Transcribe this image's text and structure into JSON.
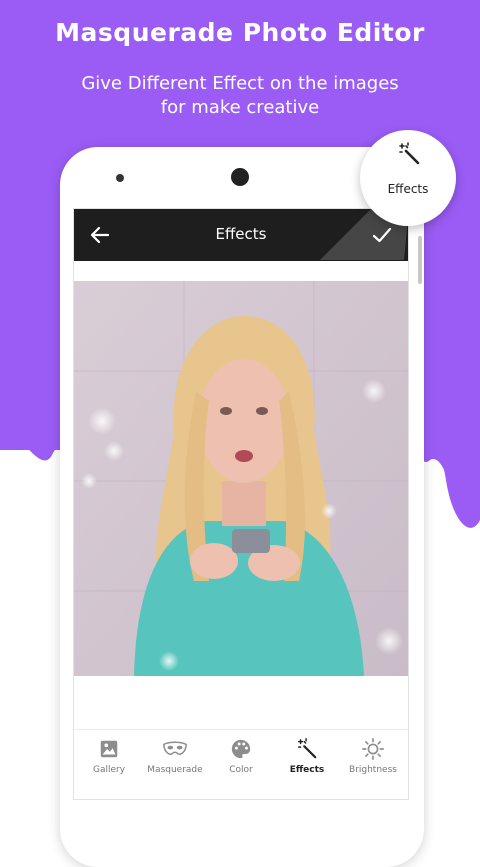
{
  "promo": {
    "headline": "Masquerade Photo Editor",
    "subline_1": "Give Different Effect on the images",
    "subline_2": "for make creative",
    "accent_color": "#9b5cf6"
  },
  "appbar": {
    "back_icon": "arrow-left-icon",
    "title": "Effects",
    "done_icon": "check-icon"
  },
  "photo": {
    "description_icon": "photo-preview"
  },
  "toolbar": {
    "items": [
      {
        "label": "Gallery",
        "icon": "image-icon"
      },
      {
        "label": "Masquerade",
        "icon": "mask-icon"
      },
      {
        "label": "Color",
        "icon": "palette-icon"
      },
      {
        "label": "Effects",
        "icon": "magic-wand-icon",
        "active": true
      },
      {
        "label": "Brightness",
        "icon": "sun-icon"
      }
    ]
  },
  "badge": {
    "label": "Effects",
    "icon": "magic-wand-icon"
  }
}
